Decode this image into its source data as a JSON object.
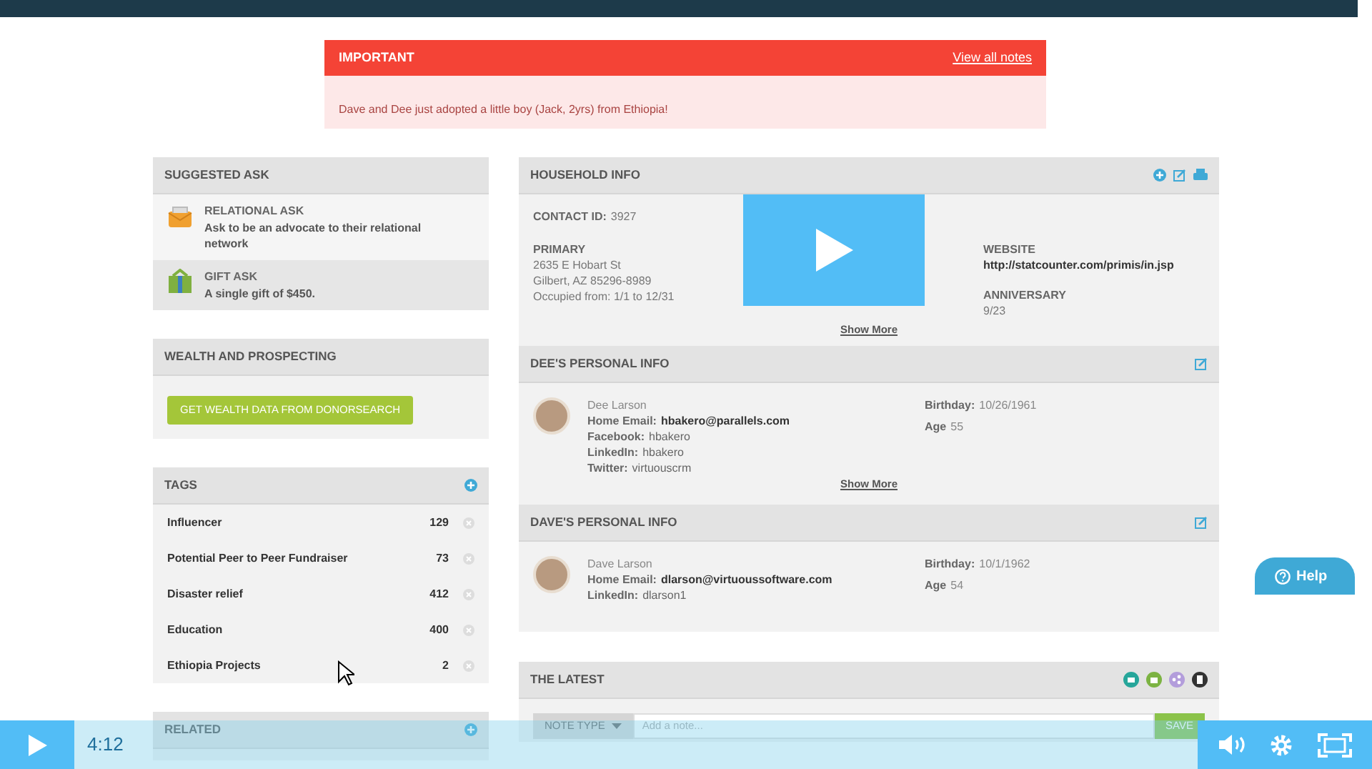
{
  "important_note": {
    "title": "IMPORTANT",
    "link": "View all notes",
    "text": "Dave and Dee just adopted a little boy (Jack, 2yrs) from Ethiopia!"
  },
  "suggested_ask": {
    "title": "SUGGESTED ASK",
    "items": [
      {
        "kind": "relational",
        "title": "RELATIONAL ASK",
        "text": "Ask to be an advocate to their relational network"
      },
      {
        "kind": "gift",
        "title": "GIFT ASK",
        "text": "A single gift of $450."
      }
    ]
  },
  "wealth": {
    "title": "WEALTH AND PROSPECTING",
    "button": "GET WEALTH DATA FROM DONORSEARCH"
  },
  "tags": {
    "title": "TAGS",
    "items": [
      {
        "label": "Influencer",
        "count": "129"
      },
      {
        "label": "Potential Peer to Peer Fundraiser",
        "count": "73"
      },
      {
        "label": "Disaster relief",
        "count": "412"
      },
      {
        "label": "Education",
        "count": "400"
      },
      {
        "label": "Ethiopia Projects",
        "count": "2"
      }
    ]
  },
  "related": {
    "title": "RELATED"
  },
  "household": {
    "title": "HOUSEHOLD INFO",
    "contact_id_label": "CONTACT ID:",
    "contact_id": "3927",
    "primary_label": "PRIMARY",
    "primary_lines": [
      "2635 E Hobart St",
      "Gilbert, AZ 85296-8989",
      "Occupied from: 1/1 to 12/31"
    ],
    "website_label": "WEBSITE",
    "website": "http://statcounter.com/primis/in.jsp",
    "anniversary_label": "ANNIVERSARY",
    "anniversary": "9/23",
    "show_more": "Show More"
  },
  "persons": [
    {
      "title": "DEE'S PERSONAL INFO",
      "name": "Dee Larson",
      "fields": [
        {
          "label": "Home Email:",
          "value": "hbakero@parallels.com",
          "bold": true
        },
        {
          "label": "Facebook:",
          "value": "hbakero",
          "bold": false
        },
        {
          "label": "LinkedIn:",
          "value": "hbakero",
          "bold": false
        },
        {
          "label": "Twitter:",
          "value": "virtuouscrm",
          "bold": false
        }
      ],
      "birthday_label": "Birthday:",
      "birthday": "10/26/1961",
      "age_label": "Age",
      "age": "55",
      "show_more": "Show More"
    },
    {
      "title": "DAVE'S PERSONAL INFO",
      "name": "Dave Larson",
      "fields": [
        {
          "label": "Home Email:",
          "value": "dlarson@virtuoussoftware.com",
          "bold": true
        },
        {
          "label": "LinkedIn:",
          "value": "dlarson1",
          "bold": false
        }
      ],
      "birthday_label": "Birthday:",
      "birthday": "10/1/1962",
      "age_label": "Age",
      "age": "54"
    }
  ],
  "latest": {
    "title": "THE LATEST",
    "note_type": "NOTE TYPE",
    "placeholder": "Add a note...",
    "save": "SAVE"
  },
  "help": {
    "label": "Help"
  },
  "player": {
    "time": "4:12"
  }
}
